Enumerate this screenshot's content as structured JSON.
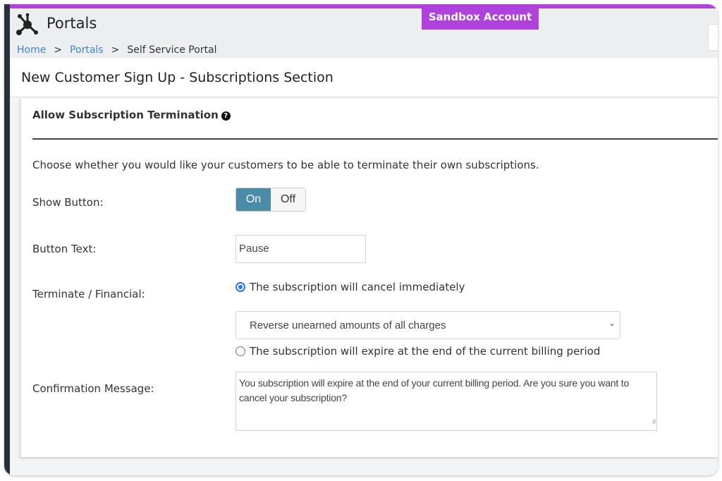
{
  "header": {
    "app_title": "Portals",
    "sandbox_badge": "Sandbox Account",
    "breadcrumb": [
      {
        "label": "Home"
      },
      {
        "label": "Portals"
      },
      {
        "label": "Self Service Portal"
      }
    ],
    "separator": ">"
  },
  "page_title": "New Customer Sign Up - Subscriptions Section",
  "section": {
    "title": "Allow Subscription Termination",
    "help_icon": "question-circle-icon",
    "description": "Choose whether you would like your customers to be able to terminate their own subscriptions.",
    "show_button": {
      "label": "Show Button:",
      "on": "On",
      "off": "Off",
      "value": "On"
    },
    "button_text": {
      "label": "Button Text:",
      "value": "Pause"
    },
    "terminate": {
      "label": "Terminate / Financial:",
      "option1": "The subscription will cancel immediately",
      "option1_selected": true,
      "select_value": "Reverse unearned amounts of all charges",
      "option2": "The subscription will expire at the end of the current billing period",
      "option2_selected": false
    },
    "confirmation": {
      "label": "Confirmation Message:",
      "value": "You subscription will expire at the end of your current billing period.  Are you sure you want to cancel your subscription?"
    }
  },
  "colors": {
    "accent_purple": "#b042dc",
    "toggle_on": "#4a8ba8",
    "link": "#3a87c8"
  }
}
